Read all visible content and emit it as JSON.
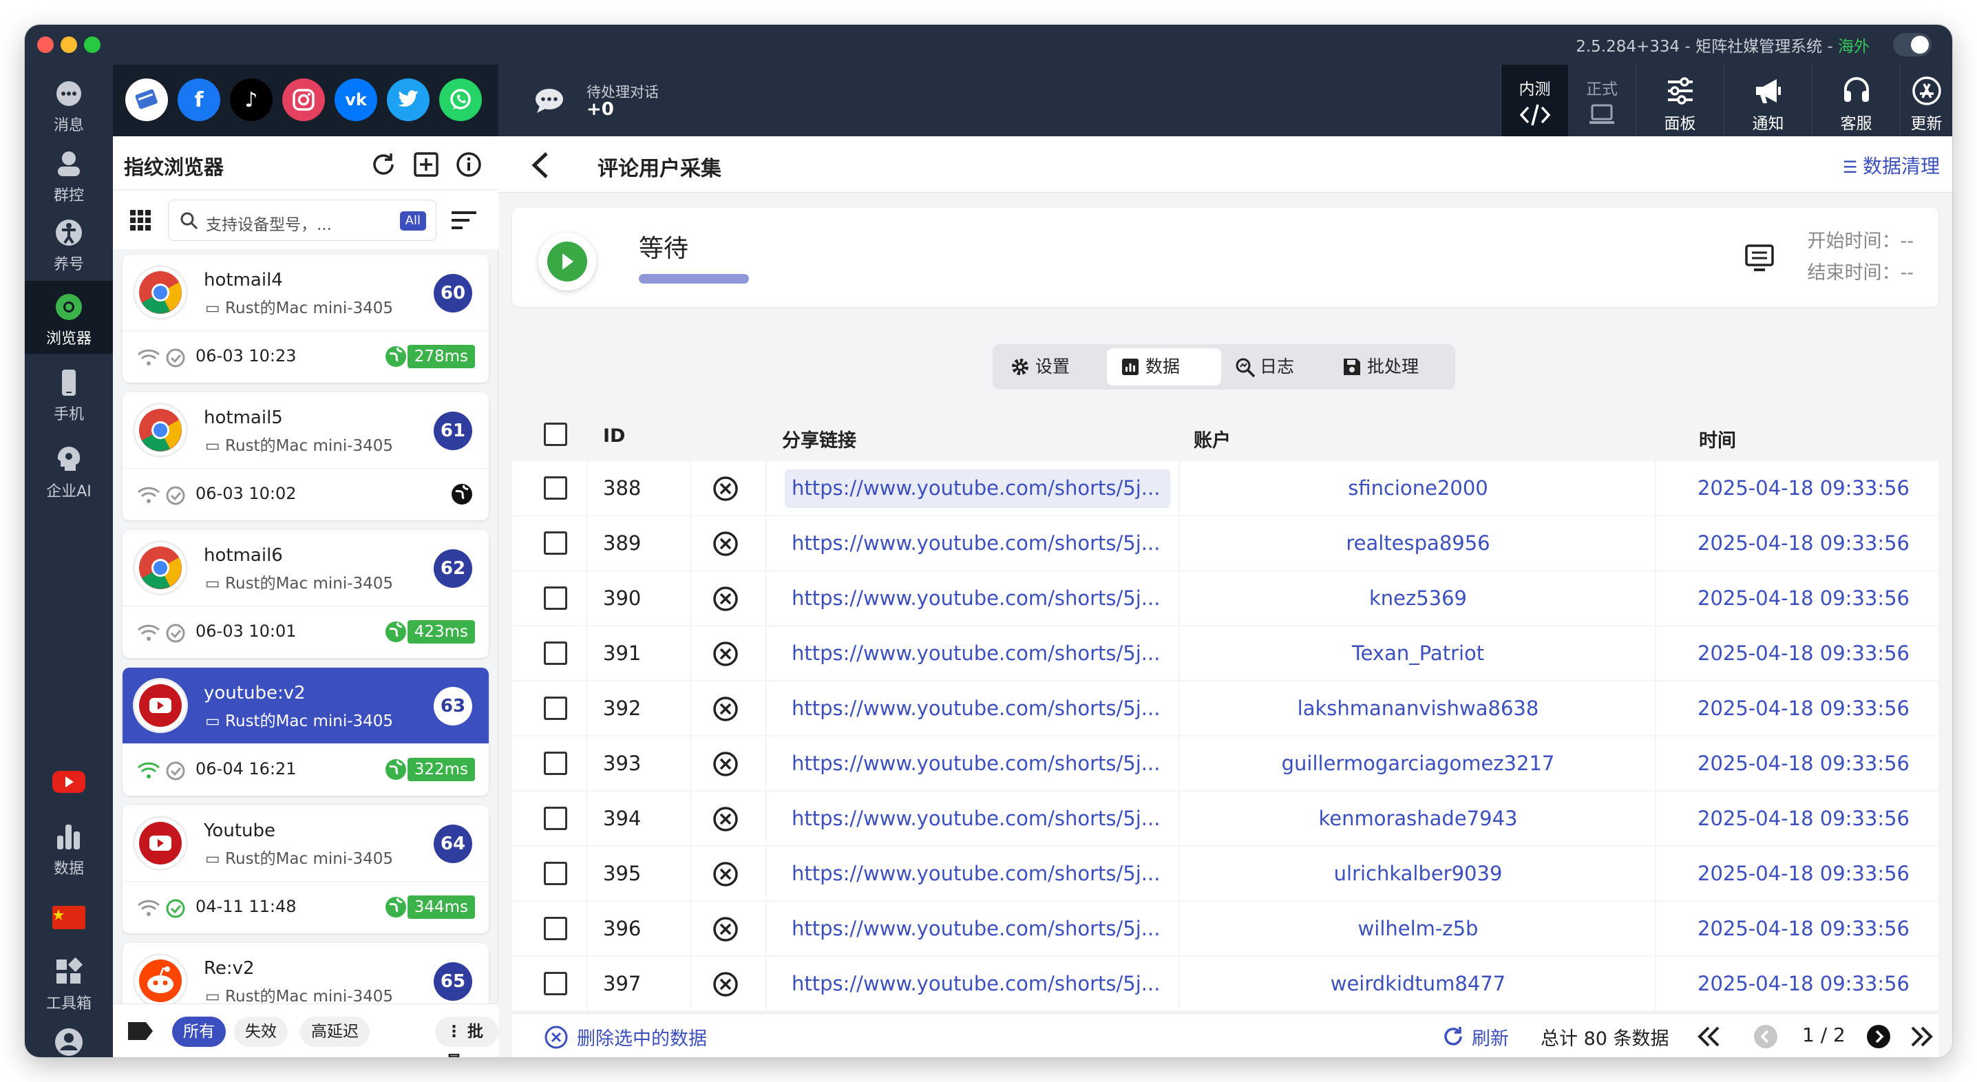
{
  "window": {
    "version_text": "2.5.284+334 - 矩阵社媒管理系统 - ",
    "region": "海外"
  },
  "sidebar": {
    "items": [
      {
        "label": "消息",
        "icon": "message-icon"
      },
      {
        "label": "群控",
        "icon": "group-control-icon"
      },
      {
        "label": "养号",
        "icon": "account-nurture-icon"
      },
      {
        "label": "浏览器",
        "icon": "browser-icon",
        "active": true
      },
      {
        "label": "手机",
        "icon": "phone-icon"
      },
      {
        "label": "企业AI",
        "icon": "ai-icon"
      },
      {
        "label": "",
        "icon": "youtube-icon"
      },
      {
        "label": "数据",
        "icon": "data-chart-icon"
      },
      {
        "label": "",
        "icon": "china-flag-icon"
      },
      {
        "label": "工具箱",
        "icon": "toolbox-icon"
      },
      {
        "label": "用户",
        "icon": "user-icon"
      }
    ]
  },
  "social": [
    "browser-icon",
    "facebook-icon",
    "tiktok-icon",
    "instagram-icon",
    "vk-icon",
    "twitter-icon",
    "whatsapp-icon"
  ],
  "topbar": {
    "pending_label": "待处理对话",
    "pending_value": "+0",
    "env_internal": "内测",
    "env_prod": "正式",
    "buttons": [
      "面板",
      "通知",
      "客服",
      "更新"
    ]
  },
  "left": {
    "title": "指纹浏览器",
    "search_placeholder": "支持设备型号，...",
    "search_badge": "All",
    "cards": [
      {
        "name": "hotmail4",
        "device": "Rust的Mac mini-3405",
        "num": "60",
        "date": "06-03 10:23",
        "ms": "278ms",
        "logo": "chrome"
      },
      {
        "name": "hotmail5",
        "device": "Rust的Mac mini-3405",
        "num": "61",
        "date": "06-03 10:02",
        "ms": "",
        "logo": "chrome"
      },
      {
        "name": "hotmail6",
        "device": "Rust的Mac mini-3405",
        "num": "62",
        "date": "06-03 10:01",
        "ms": "423ms",
        "logo": "chrome"
      },
      {
        "name": "youtube:v2",
        "device": "Rust的Mac mini-3405",
        "num": "63",
        "date": "06-04 16:21",
        "ms": "322ms",
        "logo": "youtube",
        "active": true
      },
      {
        "name": "Youtube",
        "device": "Rust的Mac mini-3405",
        "num": "64",
        "date": "04-11 11:48",
        "ms": "344ms",
        "logo": "youtube"
      },
      {
        "name": "Re:v2",
        "device": "Rust的Mac mini-3405",
        "num": "65",
        "date": "",
        "ms": "",
        "logo": "reddit"
      }
    ],
    "filters": [
      "所有",
      "失效",
      "高延迟"
    ],
    "batch": "批量"
  },
  "main": {
    "title": "评论用户采集",
    "clean": "数据清理",
    "status": "等待",
    "start_time": "开始时间：--",
    "end_time": "结束时间：--",
    "tabs": [
      "设置",
      "数据",
      "日志",
      "批处理"
    ],
    "columns": [
      "ID",
      "分享链接",
      "账户",
      "时间"
    ],
    "rows": [
      {
        "id": "388",
        "link": "https://www.youtube.com/shorts/5j...",
        "account": "sfincione2000",
        "time": "2025-04-18 09:33:56"
      },
      {
        "id": "389",
        "link": "https://www.youtube.com/shorts/5j...",
        "account": "realtespa8956",
        "time": "2025-04-18 09:33:56"
      },
      {
        "id": "390",
        "link": "https://www.youtube.com/shorts/5j...",
        "account": "knez5369",
        "time": "2025-04-18 09:33:56"
      },
      {
        "id": "391",
        "link": "https://www.youtube.com/shorts/5j...",
        "account": "Texan_Patriot",
        "time": "2025-04-18 09:33:56"
      },
      {
        "id": "392",
        "link": "https://www.youtube.com/shorts/5j...",
        "account": "lakshmananvishwa8638",
        "time": "2025-04-18 09:33:56"
      },
      {
        "id": "393",
        "link": "https://www.youtube.com/shorts/5j...",
        "account": "guillermogarciagomez3217",
        "time": "2025-04-18 09:33:56"
      },
      {
        "id": "394",
        "link": "https://www.youtube.com/shorts/5j...",
        "account": "kenmorashade7943",
        "time": "2025-04-18 09:33:56"
      },
      {
        "id": "395",
        "link": "https://www.youtube.com/shorts/5j...",
        "account": "ulrichkalber9039",
        "time": "2025-04-18 09:33:56"
      },
      {
        "id": "396",
        "link": "https://www.youtube.com/shorts/5j...",
        "account": "wilhelm-z5b",
        "time": "2025-04-18 09:33:56"
      },
      {
        "id": "397",
        "link": "https://www.youtube.com/shorts/5j...",
        "account": "weirdkidtum8477",
        "time": "2025-04-18 09:33:56"
      }
    ],
    "footer": {
      "delete": "删除选中的数据",
      "refresh": "刷新",
      "total": "总计 80 条数据",
      "page": "1 / 2"
    }
  },
  "colors": {
    "accent": "#3b4fbf",
    "sidebar": "#243041",
    "green": "#3cb34a"
  }
}
